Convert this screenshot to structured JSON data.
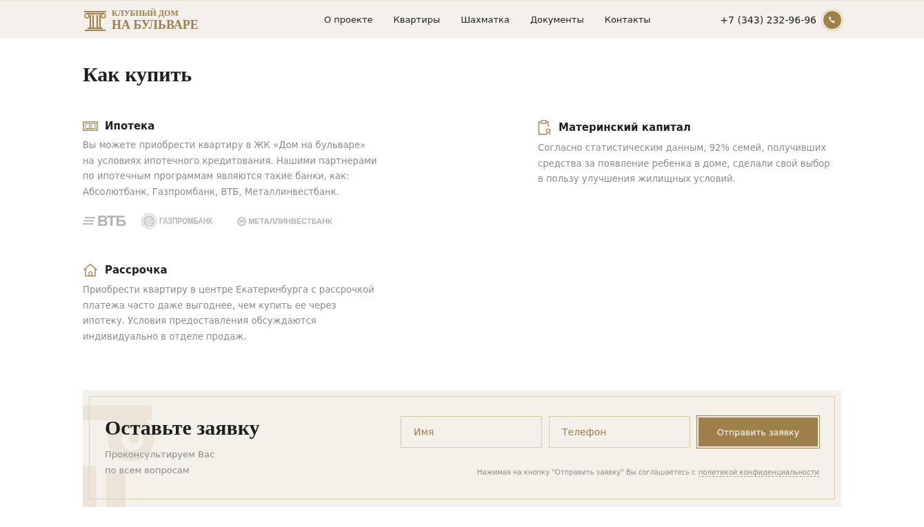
{
  "header": {
    "logo": {
      "line_1": "КЛУБНЫЙ ДОМ",
      "line_2": "НА БУЛЬВАРЕ"
    },
    "nav": [
      {
        "label": "О проекте"
      },
      {
        "label": "Квартиры"
      },
      {
        "label": "Шахматка"
      },
      {
        "label": "Документы"
      },
      {
        "label": "Контакты"
      }
    ],
    "phone": "+7 (343) 232-96-96"
  },
  "page_title": "Как купить",
  "sections": [
    {
      "kind": "mortgage",
      "title": "Ипотека",
      "text": "Вы можете приобрести квартиру в ЖК «Дом на бульваре» на условиях ипотечного кредитования. Нашими партнерами по ипотечным программам являются такие банки, как: Абсолютбанк, Газпромбанк, ВТБ, Металлинвестбанк.",
      "banks": [
        {
          "kind": "stripes",
          "name": "ВТБ"
        },
        {
          "kind": "globe",
          "name": "ГАЗПРОМБАНК"
        },
        {
          "kind": "coin",
          "name": "МЕТАЛЛИНВЕСТБАНК"
        }
      ]
    },
    {
      "kind": "capital",
      "title": "Материнский капитал",
      "text": "Согласно статистическим данным, 92% семей, получивших средства за появление ребенка в доме, сделали свой выбор в пользу улучшения жилищных условий."
    },
    {
      "kind": "installment",
      "title": "Рассрочка",
      "text": "Приобрести квартиру в центре Екатеринбурга с рассрочкой платежа часто даже выгоднее, чем купить ее через ипотеку. Условия предоставления обсуждаются индивидуально в отделе продаж."
    }
  ],
  "request_form": {
    "title": "Оставьте заявку",
    "subtitle_lines": [
      "Проконсультируем Вас",
      "по всем вопросам"
    ],
    "fields": [
      {
        "placeholder": "Имя"
      },
      {
        "placeholder": "Телефон"
      }
    ],
    "submit": "Отправить заявку",
    "consent": "Нажимая на кнопку \"Отправить заявку\" Вы соглашаетесь с",
    "consent_link": "политикой конфиденциальности"
  }
}
